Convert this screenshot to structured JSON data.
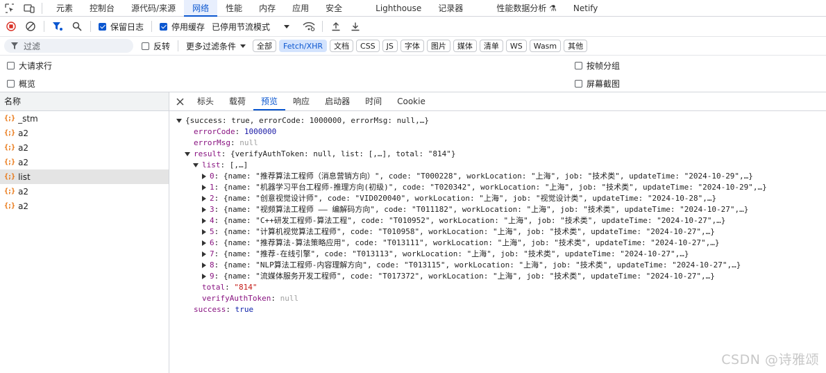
{
  "topTabs": [
    "元素",
    "控制台",
    "源代码/来源",
    "网络",
    "性能",
    "内存",
    "应用",
    "安全",
    "Lighthouse",
    "记录器",
    "性能数据分析 ⚗",
    "Netify"
  ],
  "activeTopTab": 3,
  "toolbar": {
    "preserve_log": "保留日志",
    "disable_cache": "停用缓存",
    "throttle": "已停用节流模式"
  },
  "filter": {
    "placeholder": "过滤",
    "invert": "反转",
    "more": "更多过滤条件",
    "chips": [
      "全部",
      "Fetch/XHR",
      "文档",
      "CSS",
      "JS",
      "字体",
      "图片",
      "媒体",
      "清单",
      "WS",
      "Wasm",
      "其他"
    ],
    "selected": 1
  },
  "options": {
    "big_rows": "大请求行",
    "group_by_frame": "按帧分组",
    "overview": "概览",
    "screenshots": "屏幕截图"
  },
  "list": {
    "header": "名称",
    "items": [
      "_stm",
      "a2",
      "a2",
      "a2",
      "list",
      "a2",
      "a2"
    ],
    "selected": 4
  },
  "detailTabs": [
    "标头",
    "载荷",
    "预览",
    "响应",
    "启动器",
    "时间",
    "Cookie"
  ],
  "activeDetailTab": 2,
  "preview": {
    "root": "{success: true, errorCode: 1000000, errorMsg: null,…}",
    "errorCode": "1000000",
    "errorMsg": "null",
    "result": "{verifyAuthToken: null, list: [,…], total: \"814\"}",
    "listSummary": "[,…]",
    "items": [
      "{name: \"推荐算法工程师（消息营销方向）\", code: \"T000228\", workLocation: \"上海\", job: \"技术类\", updateTime: \"2024-10-29\",…}",
      "{name: \"机器学习平台工程师-推理方向(初级)\", code: \"T020342\", workLocation: \"上海\", job: \"技术类\", updateTime: \"2024-10-29\",…}",
      "{name: \"创意视觉设计师\", code: \"VID020040\", workLocation: \"上海\", job: \"视觉设计类\", updateTime: \"2024-10-28\",…}",
      "{name: \"视频算法工程师 —— 编解码方向\", code: \"T011182\", workLocation: \"上海\", job: \"技术类\", updateTime: \"2024-10-27\",…}",
      "{name: \"C++研发工程师-算法工程\", code: \"T010952\", workLocation: \"上海\", job: \"技术类\", updateTime: \"2024-10-27\",…}",
      "{name: \"计算机视觉算法工程师\", code: \"T010958\", workLocation: \"上海\", job: \"技术类\", updateTime: \"2024-10-27\",…}",
      "{name: \"推荐算法-算法策略应用\", code: \"T013111\", workLocation: \"上海\", job: \"技术类\", updateTime: \"2024-10-27\",…}",
      "{name: \"推荐-在线引擎\", code: \"T013113\", workLocation: \"上海\", job: \"技术类\", updateTime: \"2024-10-27\",…}",
      "{name: \"NLP算法工程师-内容理解方向\", code: \"T013115\", workLocation: \"上海\", job: \"技术类\", updateTime: \"2024-10-27\",…}",
      "{name: \"流媒体服务开发工程师\", code: \"T017372\", workLocation: \"上海\", job: \"技术类\", updateTime: \"2024-10-27\",…}"
    ],
    "total": "\"814\"",
    "verifyAuthToken": "null",
    "success": "true"
  },
  "watermark": "CSDN @诗雅颂"
}
